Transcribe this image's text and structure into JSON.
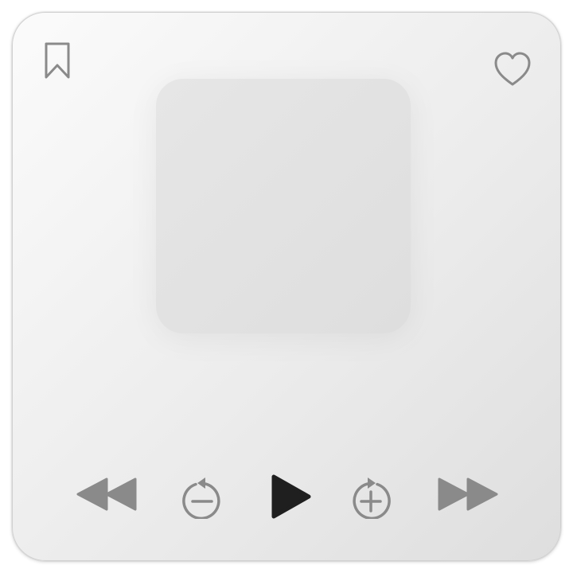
{
  "player": {
    "controls": {
      "bookmark_icon": "bookmark-icon",
      "favorite_icon": "heart-icon",
      "rewind_icon": "rewind-icon",
      "skip_back_icon": "skip-back-icon",
      "play_icon": "play-icon",
      "skip_forward_icon": "skip-forward-icon",
      "fast_forward_icon": "fast-forward-icon"
    },
    "colors": {
      "icon_gray": "#8a8a8a",
      "play_dark": "#1f1f1f",
      "card_background": "#efefef",
      "artwork_placeholder": "#e2e2e2"
    }
  }
}
